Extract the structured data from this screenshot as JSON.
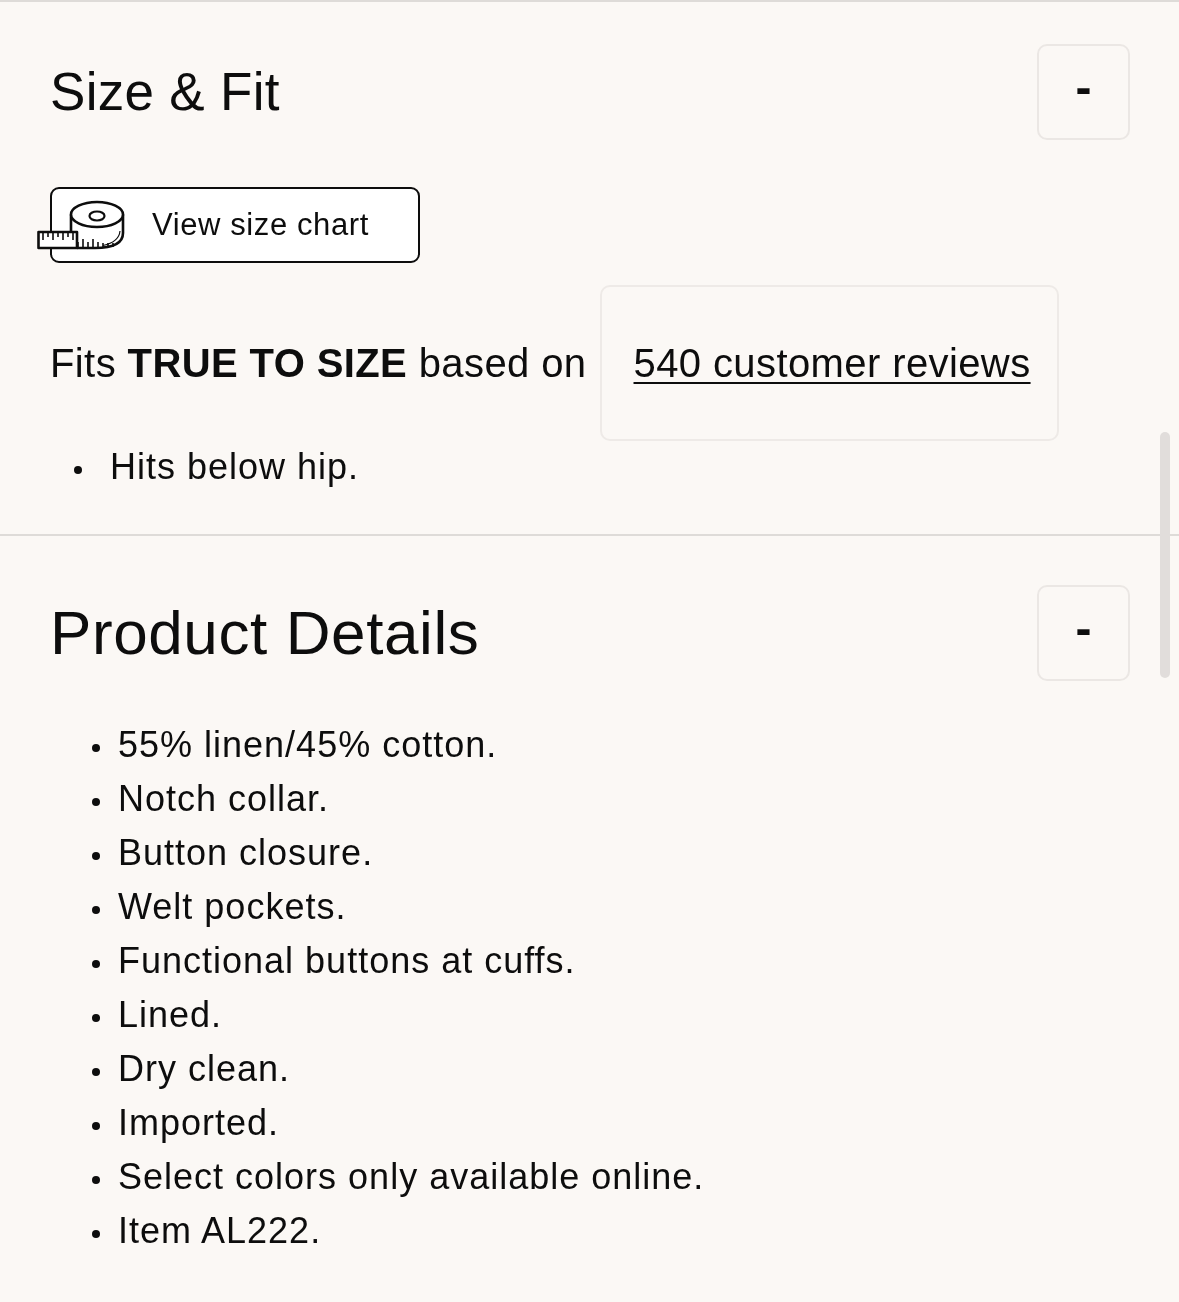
{
  "sections": [
    {
      "kind": "size_fit",
      "title": "Size & Fit",
      "toggle": "-",
      "expanded": true,
      "size_chart_button": "View size chart",
      "fit_note": "Fits **TRUE TO SIZE** based on",
      "reviews_link": "540 customer reviews",
      "bullets": [
        "Hits below hip."
      ]
    },
    {
      "kind": "details",
      "title": "Product Details",
      "toggle": "-",
      "expanded": true,
      "bullets": [
        "55% linen/45% cotton.",
        "Notch collar.",
        "Button closure.",
        "Welt pockets.",
        "Functional buttons at cuffs.",
        "Lined.",
        "Dry clean.",
        "Imported.",
        "Select colors only available online.",
        "Item AL222."
      ]
    }
  ]
}
